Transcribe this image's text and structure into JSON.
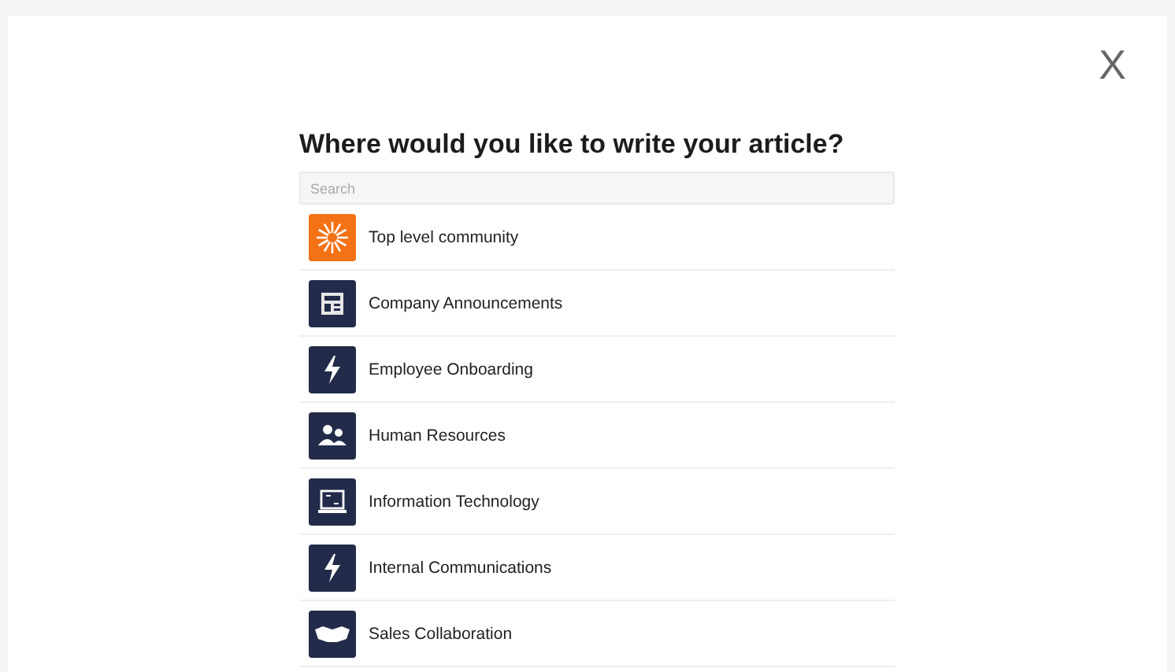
{
  "close": {
    "label": "X"
  },
  "title": "Where would you like to write your article?",
  "search": {
    "placeholder": "Search"
  },
  "communities": [
    {
      "name": "Top level community",
      "kind": "burst",
      "color": "#f47216"
    },
    {
      "name": "Company Announcements",
      "kind": "newspaper",
      "color": "#232b4a"
    },
    {
      "name": "Employee Onboarding",
      "kind": "bolt",
      "color": "#232b4a"
    },
    {
      "name": "Human Resources",
      "kind": "people",
      "color": "#232b4a"
    },
    {
      "name": "Information Technology",
      "kind": "laptop",
      "color": "#232b4a"
    },
    {
      "name": "Internal Communications",
      "kind": "bolt",
      "color": "#232b4a"
    },
    {
      "name": "Sales Collaboration",
      "kind": "handshake",
      "color": "#232b4a"
    }
  ]
}
